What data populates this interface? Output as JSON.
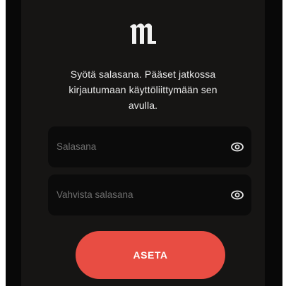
{
  "logo": {
    "icon": "brand-m-logo-icon"
  },
  "intro": {
    "line1": "Syötä salasana. Pääset jatkossa",
    "line2": "kirjautumaan käyttöliittymään sen",
    "line3": "avulla."
  },
  "fields": {
    "password_placeholder": "Salasana",
    "confirm_placeholder": "Vahvista salasana"
  },
  "actions": {
    "set_label": "ASETA"
  },
  "colors": {
    "background": "#161514",
    "field": "#0b0b0b",
    "accent": "#e84d43",
    "text": "#eaeaea",
    "placeholder": "#6f6f6f"
  }
}
